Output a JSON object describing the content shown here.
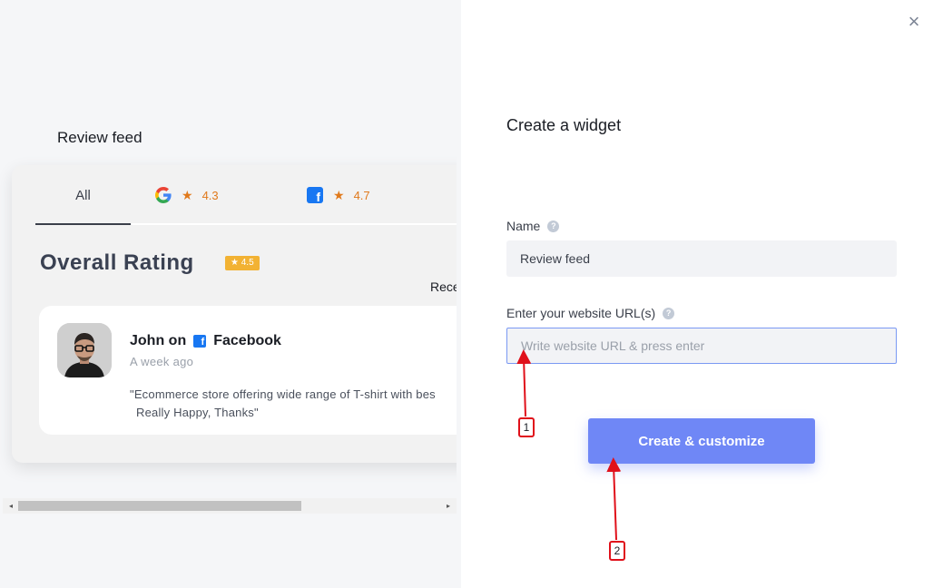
{
  "preview": {
    "title": "Review feed",
    "tabs": {
      "all_label": "All",
      "google_rating": "4.3",
      "facebook_rating": "4.7",
      "star_glyph": "★"
    },
    "overall_label": "Overall Rating",
    "overall_badge": "★ 4.5",
    "recent_label": "Rece",
    "review": {
      "reviewer": "John on",
      "platform": "Facebook",
      "time": "A week ago",
      "text_line1": "\"Ecommerce store offering wide range of T-shirt with bes",
      "text_line2": "Really Happy, Thanks\""
    }
  },
  "panel": {
    "close_glyph": "×",
    "title": "Create a widget",
    "name_label": "Name",
    "name_value": "Review feed",
    "url_label": "Enter your website URL(s)",
    "url_placeholder": "Write website URL & press enter",
    "submit_label": "Create & customize",
    "help_glyph": "?"
  },
  "annotations": {
    "marker_1": "1",
    "marker_2": "2",
    "color": "#e0101a"
  },
  "colors": {
    "accent": "#6f87f6",
    "rating_orange": "#e0791b",
    "badge_yellow": "#f2b233",
    "facebook_blue": "#1877f2"
  }
}
